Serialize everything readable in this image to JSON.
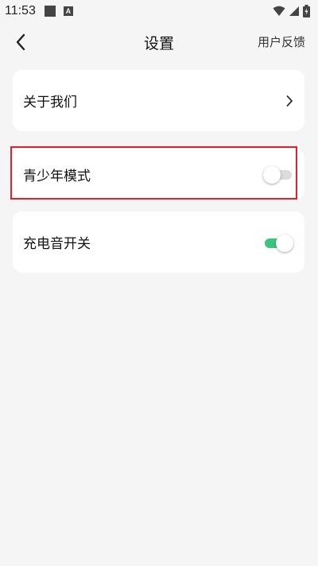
{
  "status_bar": {
    "time": "11:53",
    "icons": [
      "notification-square-icon",
      "a-badge-icon",
      "wifi-icon",
      "signal-icon",
      "battery-icon"
    ]
  },
  "header": {
    "title": "设置",
    "feedback_label": "用户反馈",
    "back_icon": "back-chevron-icon"
  },
  "settings": {
    "about": {
      "label": "关于我们",
      "icon": "chevron-right-icon"
    },
    "youth_mode": {
      "label": "青少年模式",
      "enabled": false
    },
    "charge_sound": {
      "label": "充电音开关",
      "enabled": true
    }
  },
  "colors": {
    "background": "#f5f5f5",
    "card": "#ffffff",
    "toggle_on": "#3cc47c",
    "toggle_off": "#dcdcdc",
    "highlight": "#e0202a"
  }
}
